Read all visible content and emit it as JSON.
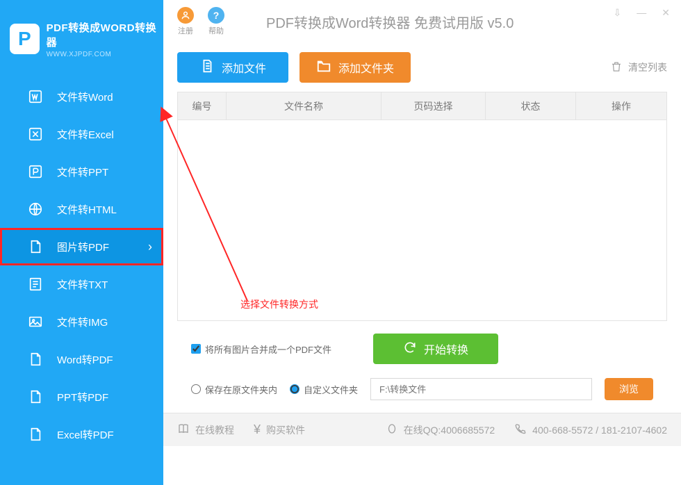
{
  "logo": {
    "title": "PDF转换成WORD转换器",
    "subtitle": "WWW.XJPDF.COM",
    "letter": "P"
  },
  "sidebar": {
    "items": [
      {
        "label": "文件转Word"
      },
      {
        "label": "文件转Excel"
      },
      {
        "label": "文件转PPT"
      },
      {
        "label": "文件转HTML"
      },
      {
        "label": "图片转PDF"
      },
      {
        "label": "文件转TXT"
      },
      {
        "label": "文件转IMG"
      },
      {
        "label": "Word转PDF"
      },
      {
        "label": "PPT转PDF"
      },
      {
        "label": "Excel转PDF"
      }
    ]
  },
  "titlebar": {
    "register": "注册",
    "help": "帮助",
    "app_title": "PDF转换成Word转换器 免费试用版 v5.0"
  },
  "toolbar": {
    "add_file": "添加文件",
    "add_folder": "添加文件夹",
    "clear_list": "清空列表"
  },
  "table": {
    "headers": {
      "num": "编号",
      "name": "文件名称",
      "pages": "页码选择",
      "status": "状态",
      "action": "操作"
    }
  },
  "annotation": "选择文件转换方式",
  "options": {
    "merge_label": "将所有图片合并成一个PDF文件",
    "start_convert": "开始转换"
  },
  "save": {
    "same_folder": "保存在原文件夹内",
    "custom_folder": "自定义文件夹",
    "path_placeholder": "F:\\转换文件",
    "browse": "浏览"
  },
  "footer": {
    "tutorial": "在线教程",
    "buy": "购买软件",
    "qq": "在线QQ:4006685572",
    "phone": "400-668-5572 / 181-2107-4602"
  }
}
